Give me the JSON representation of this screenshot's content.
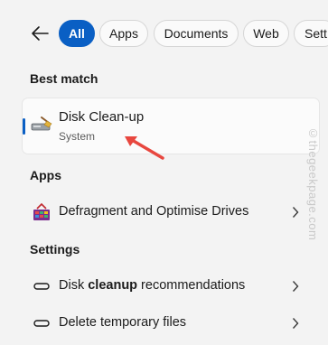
{
  "filters": [
    {
      "label": "All",
      "active": true
    },
    {
      "label": "Apps"
    },
    {
      "label": "Documents"
    },
    {
      "label": "Web"
    },
    {
      "label": "Sett"
    }
  ],
  "best_match": {
    "heading": "Best match",
    "title": "Disk Clean-up",
    "subtitle": "System"
  },
  "apps": {
    "heading": "Apps",
    "items": [
      {
        "label": "Defragment and Optimise Drives"
      }
    ]
  },
  "settings": {
    "heading": "Settings",
    "items": [
      {
        "label_pre": "Disk ",
        "label_bold": "cleanup",
        "label_post": " recommendations"
      },
      {
        "label": "Delete temporary files"
      }
    ]
  },
  "watermark": "©thegeekpage.com",
  "colors": {
    "accent": "#0a5fc4",
    "annotation_arrow": "#e8473f"
  },
  "icons": [
    "back-arrow-icon",
    "disk-cleanup-icon",
    "defragment-icon",
    "storage-icon",
    "chevron-right-icon"
  ]
}
